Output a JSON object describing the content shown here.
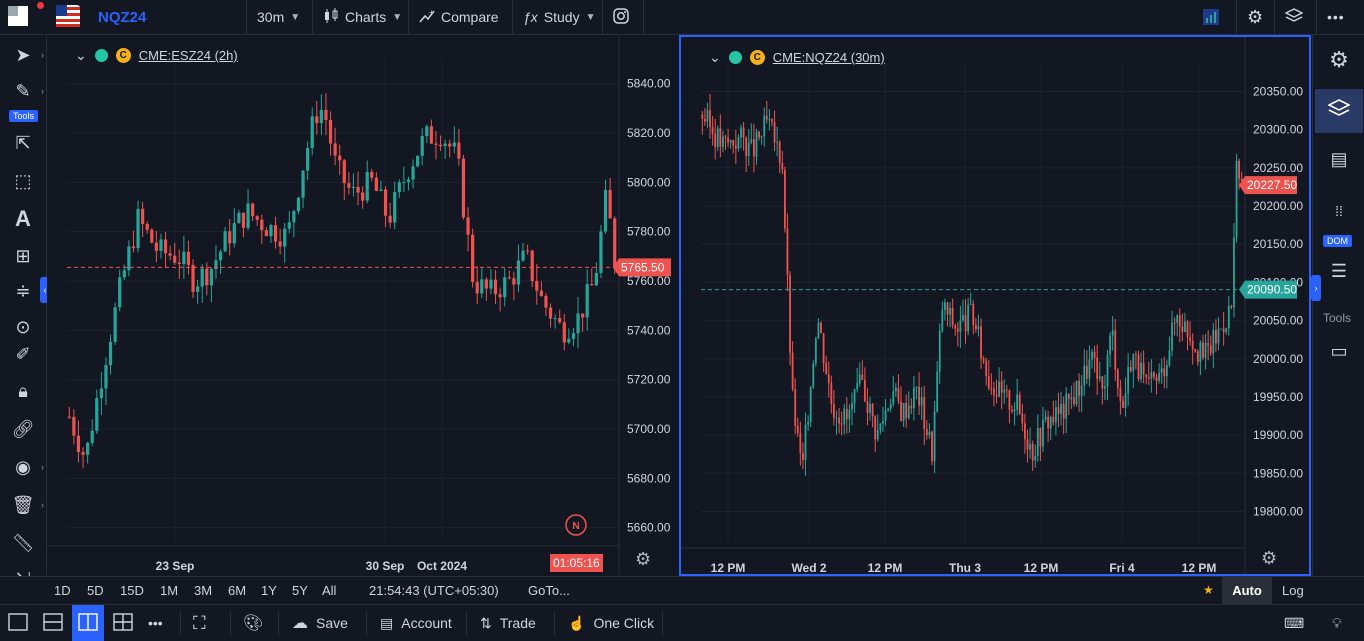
{
  "header": {
    "symbol": "NQZ24",
    "interval": "30m",
    "charts_label": "Charts",
    "compare_label": "Compare",
    "study_label": "Study"
  },
  "left_tools": {
    "tools_badge": "Tools"
  },
  "right_tools": {
    "dom_badge": "DOM",
    "tools_label": "Tools"
  },
  "chart_data": [
    {
      "type": "candlestick",
      "title": "CME:ESZ24 (2h)",
      "y_ticks": [
        "5840.00",
        "5820.00",
        "5800.00",
        "5780.00",
        "5760.00",
        "5740.00",
        "5720.00",
        "5700.00",
        "5680.00",
        "5660.00"
      ],
      "ylim": [
        5655,
        5850
      ],
      "x_ticks": [
        "23 Sep",
        "30 Sep",
        "Oct 2024"
      ],
      "last_price": "5765.50",
      "countdown": "01:05:16",
      "marker": "N",
      "path": [
        [
          0,
          5705
        ],
        [
          4,
          5688
        ],
        [
          8,
          5722
        ],
        [
          13,
          5760
        ],
        [
          17,
          5785
        ],
        [
          22,
          5772
        ],
        [
          27,
          5770
        ],
        [
          31,
          5760
        ],
        [
          35,
          5765
        ],
        [
          40,
          5780
        ],
        [
          44,
          5788
        ],
        [
          49,
          5782
        ],
        [
          54,
          5778
        ],
        [
          58,
          5808
        ],
        [
          61,
          5828
        ],
        [
          63,
          5830
        ],
        [
          66,
          5806
        ],
        [
          70,
          5795
        ],
        [
          75,
          5800
        ],
        [
          79,
          5785
        ],
        [
          84,
          5806
        ],
        [
          88,
          5818
        ],
        [
          92,
          5820
        ],
        [
          96,
          5810
        ],
        [
          100,
          5760
        ],
        [
          104,
          5755
        ],
        [
          109,
          5760
        ],
        [
          113,
          5770
        ],
        [
          117,
          5752
        ],
        [
          122,
          5740
        ],
        [
          126,
          5745
        ],
        [
          130,
          5760
        ],
        [
          133,
          5795
        ],
        [
          135,
          5768
        ]
      ],
      "colors": {
        "up": "#26a69a",
        "down": "#ef5350"
      }
    },
    {
      "type": "candlestick",
      "title": "CME:NQZ24 (30m)",
      "y_ticks": [
        "20350.00",
        "20300.00",
        "20250.00",
        "20200.00",
        "20150.00",
        "20100.00",
        "20050.00",
        "20000.00",
        "19950.00",
        "19900.00",
        "19850.00",
        "19800.00"
      ],
      "ylim": [
        19760,
        20390
      ],
      "x_ticks": [
        "12 PM",
        "Wed 2",
        "12 PM",
        "Thu 3",
        "12 PM",
        "Fri 4",
        "12 PM"
      ],
      "last_price": "20227.50",
      "line_price": "20090.50",
      "path": [
        [
          0,
          20320
        ],
        [
          8,
          20280
        ],
        [
          16,
          20290
        ],
        [
          20,
          20270
        ],
        [
          26,
          20310
        ],
        [
          32,
          20260
        ],
        [
          36,
          19950
        ],
        [
          40,
          19850
        ],
        [
          46,
          20060
        ],
        [
          52,
          19940
        ],
        [
          58,
          19920
        ],
        [
          64,
          19970
        ],
        [
          70,
          19900
        ],
        [
          76,
          19960
        ],
        [
          80,
          19930
        ],
        [
          86,
          19960
        ],
        [
          92,
          19880
        ],
        [
          96,
          20070
        ],
        [
          102,
          20040
        ],
        [
          108,
          20060
        ],
        [
          114,
          19980
        ],
        [
          120,
          19950
        ],
        [
          126,
          19940
        ],
        [
          132,
          19880
        ],
        [
          138,
          19920
        ],
        [
          144,
          19930
        ],
        [
          150,
          19960
        ],
        [
          156,
          20000
        ],
        [
          160,
          19950
        ],
        [
          164,
          20040
        ],
        [
          168,
          19930
        ],
        [
          172,
          20010
        ],
        [
          178,
          19960
        ],
        [
          184,
          19980
        ],
        [
          190,
          20060
        ],
        [
          196,
          20030
        ],
        [
          200,
          20000
        ],
        [
          206,
          20030
        ],
        [
          212,
          20070
        ],
        [
          214,
          20250
        ],
        [
          216,
          20220
        ]
      ],
      "colors": {
        "up": "#26a69a",
        "down": "#ef5350"
      }
    }
  ],
  "bottom": {
    "ranges": [
      "1D",
      "5D",
      "15D",
      "1M",
      "3M",
      "6M",
      "1Y",
      "5Y",
      "All"
    ],
    "time": "21:54:43 (UTC+05:30)",
    "goto": "GoTo...",
    "auto": "Auto",
    "log": "Log"
  },
  "footer": {
    "save": "Save",
    "account": "Account",
    "trade": "Trade",
    "one_click": "One Click"
  }
}
